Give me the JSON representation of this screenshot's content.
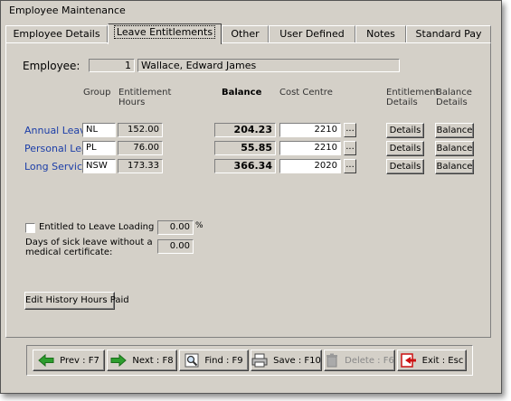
{
  "window": {
    "title": "Employee Maintenance"
  },
  "tabs": [
    {
      "label": "Employee Details"
    },
    {
      "label": "Leave Entitlements"
    },
    {
      "label": "Other"
    },
    {
      "label": "User Defined"
    },
    {
      "label": "Notes"
    },
    {
      "label": "Standard Pay"
    }
  ],
  "employee": {
    "label": "Employee:",
    "number": "1",
    "name": "Wallace, Edward James"
  },
  "headers": {
    "group": "Group",
    "entitlement_hours_1": "Entitlement",
    "entitlement_hours_2": "Hours",
    "balance": "Balance",
    "cost_centre": "Cost Centre",
    "entitlement_details_1": "Entitlement",
    "entitlement_details_2": "Details",
    "balance_details_1": "Balance",
    "balance_details_2": "Details"
  },
  "leave_rows": [
    {
      "name": "Annual Leave",
      "group": "NL",
      "hours": "152.00",
      "balance": "204.23",
      "cost_centre": "2210",
      "details_btn": "Details",
      "balance_btn": "Balance",
      "ellipsis": "..."
    },
    {
      "name": "Personal Leave",
      "group": "PL",
      "hours": "76.00",
      "balance": "55.85",
      "cost_centre": "2210",
      "details_btn": "Details",
      "balance_btn": "Balance",
      "ellipsis": "..."
    },
    {
      "name": "Long Service",
      "group": "NSW",
      "hours": "173.33",
      "balance": "366.34",
      "cost_centre": "2020",
      "details_btn": "Details",
      "balance_btn": "Balance",
      "ellipsis": "..."
    }
  ],
  "leave_loading": {
    "label": "Entitled to Leave Loading at",
    "value": "0.00",
    "unit": "%",
    "checked": false
  },
  "sick_leave": {
    "label_1": "Days of sick leave without a",
    "label_2": "medical certificate:",
    "value": "0.00"
  },
  "edit_history_button": "Edit History Hours Paid",
  "nav_buttons": {
    "prev": "Prev : F7",
    "next": "Next : F8",
    "find": "Find : F9",
    "save": "Save : F10",
    "delete": "Delete : F6",
    "exit": "Exit : Esc"
  },
  "colors": {
    "link": "#1c3ea8",
    "arrow_green": "#2e9e2e",
    "exit_red": "#cc1111"
  }
}
